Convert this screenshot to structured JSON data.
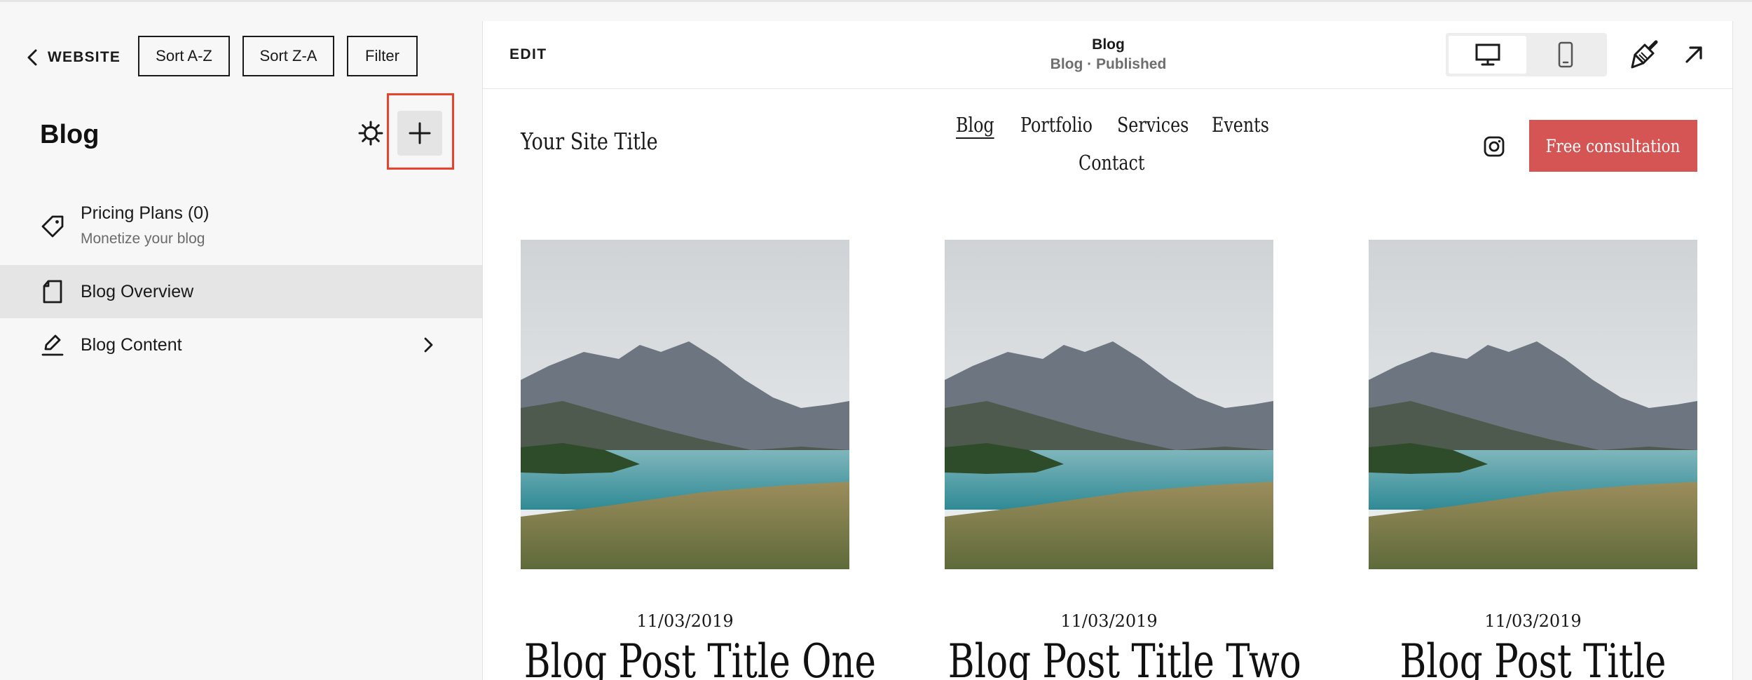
{
  "toolbar": {
    "back_label": "WEBSITE",
    "sort_az_label": "Sort A-Z",
    "sort_za_label": "Sort Z-A",
    "filter_label": "Filter"
  },
  "panel": {
    "title": "Blog",
    "items": [
      {
        "label": "Pricing Plans (0)",
        "sublabel": "Monetize your blog",
        "icon": "tag-icon"
      },
      {
        "label": "Blog Overview",
        "icon": "page-icon",
        "active": true
      },
      {
        "label": "Blog Content",
        "icon": "edit-pen-icon",
        "has_chevron": true
      }
    ]
  },
  "preview_bar": {
    "edit_label": "EDIT",
    "title": "Blog",
    "subtitle": "Blog · Published",
    "device_selected": "desktop"
  },
  "site": {
    "title": "Your Site Title",
    "nav": [
      "Blog",
      "Portfolio",
      "Services",
      "Events",
      "Contact"
    ],
    "current_nav": "Blog",
    "cta_label": "Free consultation"
  },
  "posts": [
    {
      "date": "11/03/2019",
      "title": "Blog Post Title One"
    },
    {
      "date": "11/03/2019",
      "title": "Blog Post Title Two"
    },
    {
      "date": "11/03/2019",
      "title": "Blog Post Title"
    }
  ],
  "colors": {
    "highlight": "#e8412c",
    "cta": "#d55454",
    "active_item": "#e5e5e5",
    "panel_bg": "#f7f7f7"
  }
}
